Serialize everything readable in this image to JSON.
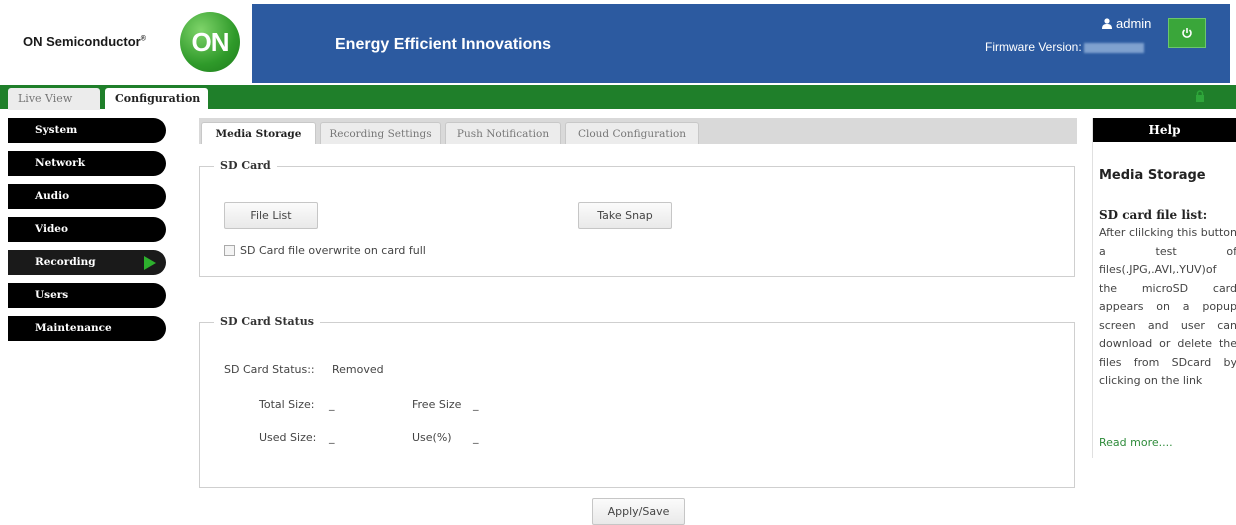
{
  "header": {
    "brand": "ON Semiconductor",
    "brand_mark": "®",
    "logo_text": "ON",
    "title": "Energy Efficient Innovations",
    "user": "admin",
    "firmware_label": "Firmware Version:",
    "power_icon": "power-icon",
    "banner_color": "#2c5aa0"
  },
  "top_tabs": [
    {
      "label": "Live View"
    },
    {
      "label": "Configuration"
    }
  ],
  "sidebar": {
    "items": [
      {
        "label": "System"
      },
      {
        "label": "Network"
      },
      {
        "label": "Audio"
      },
      {
        "label": "Video"
      },
      {
        "label": "Recording"
      },
      {
        "label": "Users"
      },
      {
        "label": "Maintenance"
      }
    ],
    "active": "Recording"
  },
  "sub_tabs": [
    {
      "label": "Media Storage"
    },
    {
      "label": "Recording Settings"
    },
    {
      "label": "Push Notification"
    },
    {
      "label": "Cloud Configuration"
    }
  ],
  "sd_card": {
    "legend": "SD Card",
    "file_list_label": "File List",
    "take_snap_label": "Take Snap",
    "overwrite_label": "SD Card file overwrite on card full",
    "overwrite_checked": false
  },
  "sd_status": {
    "legend": "SD Card Status",
    "status_label": "SD Card Status::",
    "status_value": "Removed",
    "total_label": "Total Size:",
    "total_value": "_",
    "free_label": "Free Size",
    "free_value": "_",
    "used_label": "Used Size:",
    "used_value": "_",
    "use_pct_label": "Use(%)",
    "use_pct_value": "_"
  },
  "apply_label": "Apply/Save",
  "help": {
    "heading": "Help",
    "title": "Media Storage",
    "subtitle": "SD card file list:",
    "text": "After clilcking this button a test of files(.JPG,.AVI,.YUV)of the microSD card appears on a popup screen and user can download or delete the files from SDcard by clicking on the link",
    "link": "Read more...."
  }
}
